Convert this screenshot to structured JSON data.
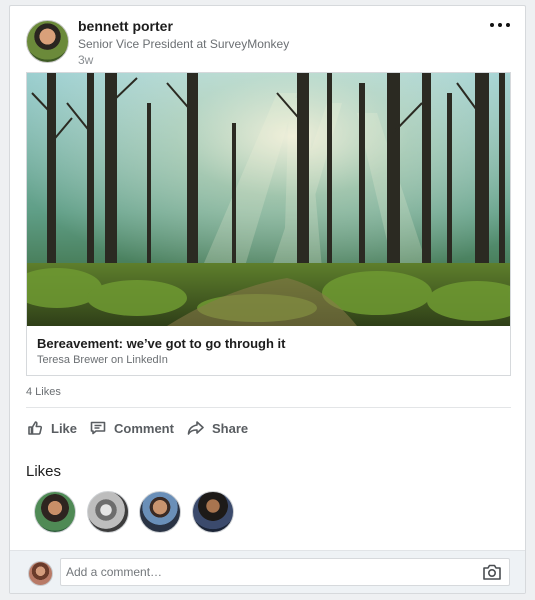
{
  "post": {
    "author_name": "bennett porter",
    "author_title": "Senior Vice President at SurveyMonkey",
    "age": "3w",
    "more_icon": "more-horizontal-icon"
  },
  "article": {
    "title": "Bereavement: we’ve got to go through it",
    "source": "Teresa Brewer on LinkedIn",
    "image_subject": "sunlit forest"
  },
  "stats": {
    "likes_count": "4 Likes"
  },
  "actions": [
    {
      "label": "Like",
      "icon": "thumbs-up-icon"
    },
    {
      "label": "Comment",
      "icon": "comment-icon"
    },
    {
      "label": "Share",
      "icon": "share-icon"
    }
  ],
  "likes_section": {
    "heading": "Likes",
    "avatar_count": 4
  },
  "comment_box": {
    "placeholder": "Add a comment…",
    "camera_icon": "camera-icon"
  },
  "colors": {
    "card_background": "#ffffff",
    "page_background": "#eef0f2",
    "action_text": "#595d61",
    "secondary_text": "#6b6f73"
  }
}
